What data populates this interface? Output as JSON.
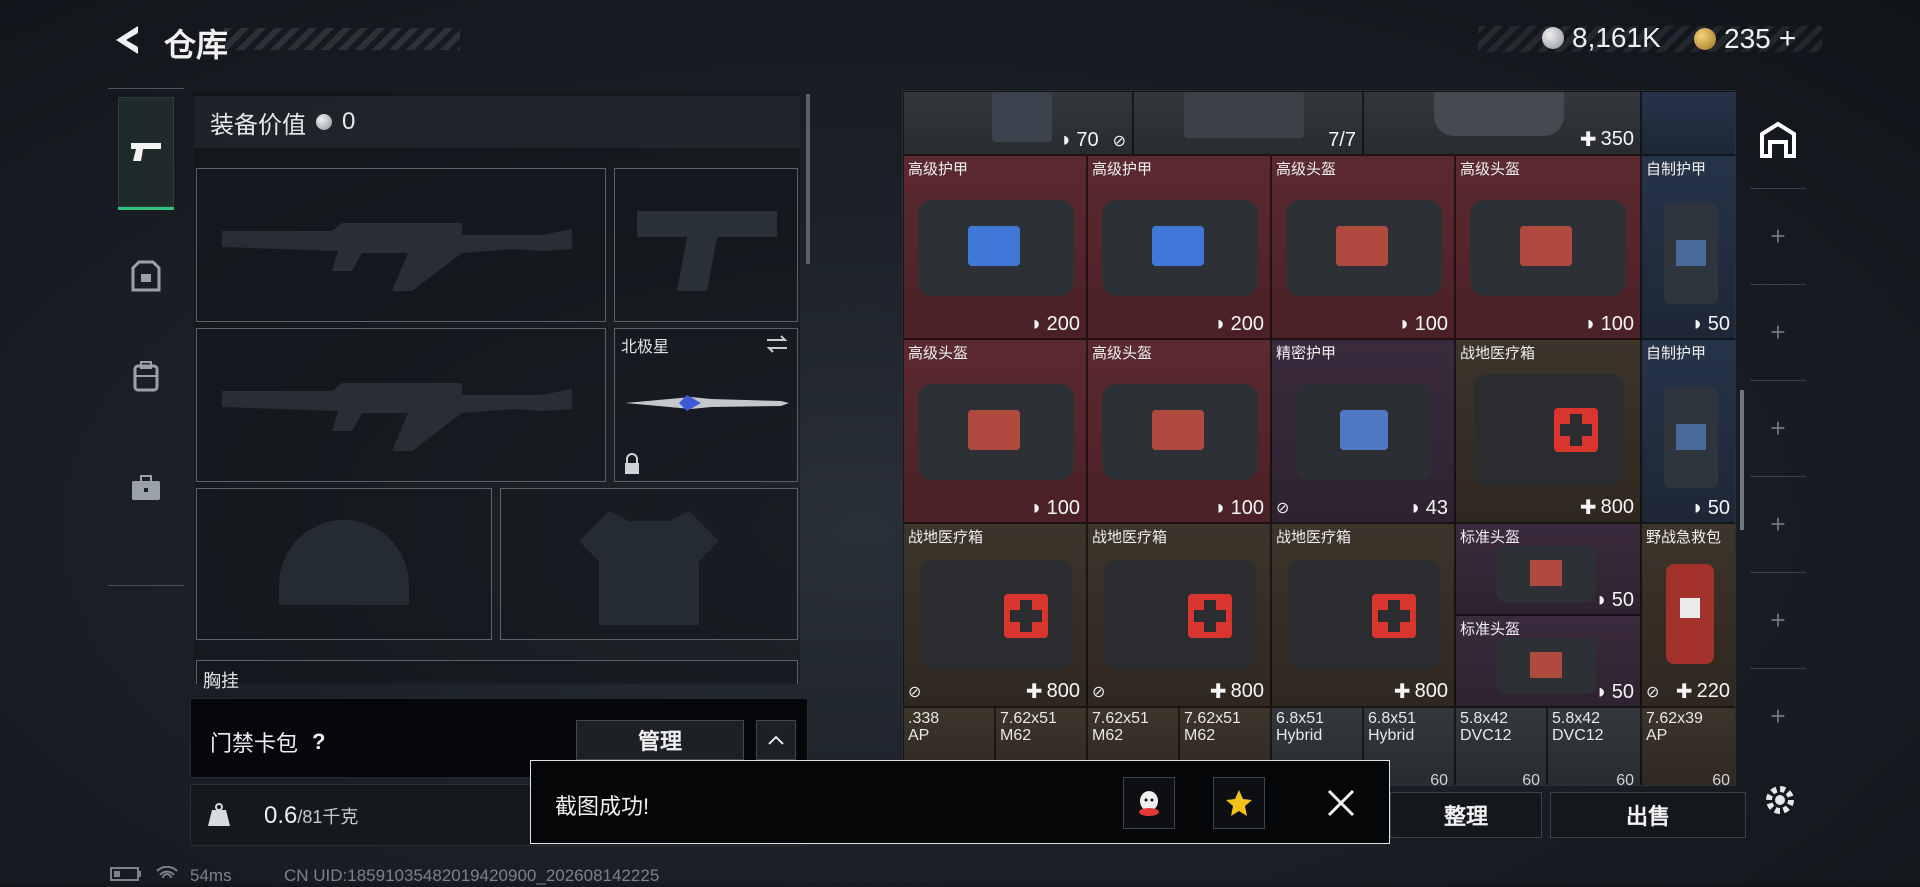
{
  "header": {
    "title": "仓库",
    "currency1": "8,161K",
    "currency2": "235"
  },
  "equipment": {
    "value_label": "装备价值",
    "value": "0",
    "knife_name": "北极星",
    "chest_label": "胸挂"
  },
  "access_card": {
    "label": "门禁卡包",
    "manage": "管理"
  },
  "weight": {
    "current": "0.6",
    "rest": "/81千克"
  },
  "grid": {
    "top_row": [
      {
        "value": "70"
      },
      {
        "value": "7/7"
      },
      {
        "value": "350"
      }
    ],
    "rows": [
      [
        {
          "name": "高级护甲",
          "value": "200",
          "kind": "armor"
        },
        {
          "name": "高级护甲",
          "value": "200",
          "kind": "armor"
        },
        {
          "name": "高级头盔",
          "value": "100",
          "kind": "helmet"
        },
        {
          "name": "高级头盔",
          "value": "100",
          "kind": "helmet"
        },
        {
          "name": "自制护甲",
          "value": "50",
          "kind": "vest"
        }
      ],
      [
        {
          "name": "高级头盔",
          "value": "100",
          "kind": "helmet"
        },
        {
          "name": "高级头盔",
          "value": "100",
          "kind": "helmet"
        },
        {
          "name": "精密护甲",
          "value": "43",
          "kind": "armor"
        },
        {
          "name": "战地医疗箱",
          "value": "800",
          "kind": "medkit"
        },
        {
          "name": "自制护甲",
          "value": "50",
          "kind": "vest"
        }
      ],
      [
        {
          "name": "战地医疗箱",
          "value": "800",
          "kind": "medkit"
        },
        {
          "name": "战地医疗箱",
          "value": "800",
          "kind": "medkit"
        },
        {
          "name": "战地医疗箱",
          "value": "800",
          "kind": "medkit"
        },
        {
          "name": "标准头盔",
          "value": "50",
          "kind": "helmet"
        },
        {
          "name": "野战急救包",
          "value": "220",
          "kind": "firstaid"
        }
      ]
    ],
    "extra_small": {
      "name": "标准头盔",
      "value": "50"
    },
    "ammo": [
      {
        "name": ".338\nAP",
        "qty": ""
      },
      {
        "name": "7.62x51\nM62",
        "qty": ""
      },
      {
        "name": "7.62x51\nM62",
        "qty": ""
      },
      {
        "name": "7.62x51\nM62",
        "qty": ""
      },
      {
        "name": "6.8x51\nHybrid",
        "qty": ""
      },
      {
        "name": "6.8x51\nHybrid",
        "qty": "60"
      },
      {
        "name": "5.8x42\nDVC12",
        "qty": "60"
      },
      {
        "name": "5.8x42\nDVC12",
        "qty": "60"
      },
      {
        "name": "7.62x39\nAP",
        "qty": "60"
      }
    ]
  },
  "buttons": {
    "sort": "整理",
    "sell": "出售"
  },
  "toast": {
    "message": "截图成功!"
  },
  "status": {
    "ping": "54ms",
    "uid": "CN UID:18591035482019420900_202608142225"
  },
  "colors": {
    "accent_green": "#2ec27e",
    "toast_border": "#dfe3e6"
  }
}
